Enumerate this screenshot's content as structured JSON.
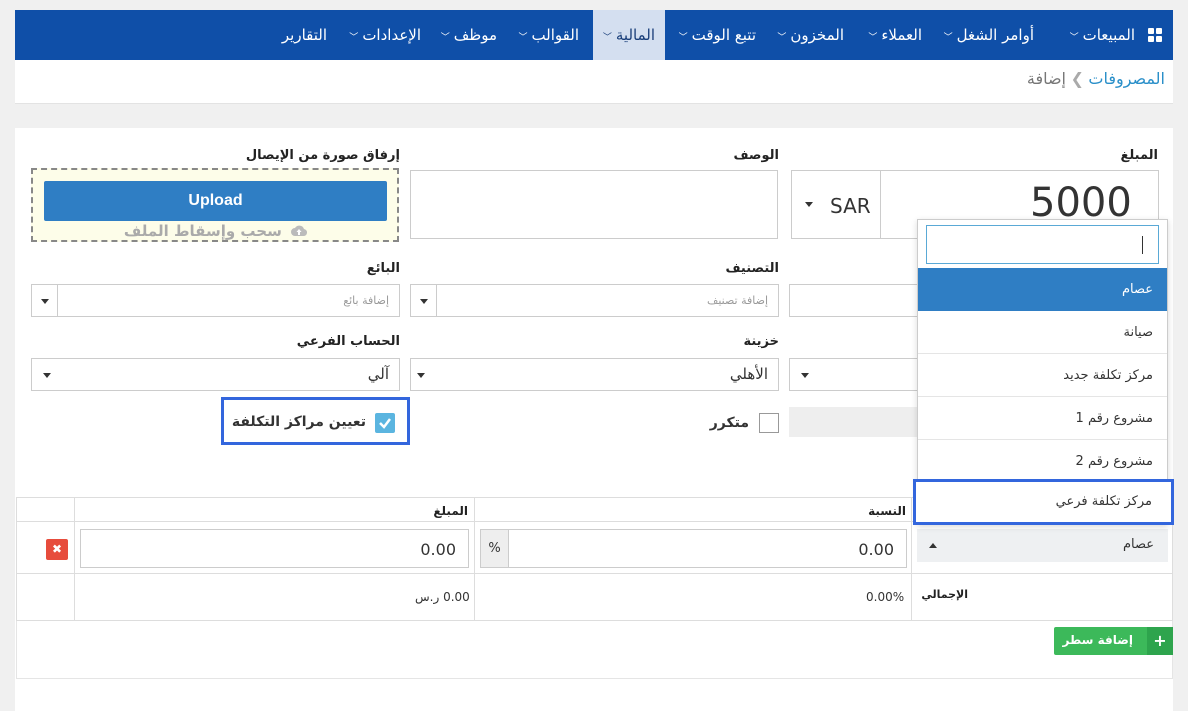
{
  "nav": {
    "items": [
      {
        "label": "المبيعات",
        "arrow": true
      },
      {
        "label": "أوامر الشغل",
        "arrow": true
      },
      {
        "label": "العملاء",
        "arrow": true
      },
      {
        "label": "المخزون",
        "arrow": true
      },
      {
        "label": "تتبع الوقت",
        "arrow": true
      },
      {
        "label": "المالية",
        "arrow": true
      },
      {
        "label": "القوالب",
        "arrow": true
      },
      {
        "label": "موظف",
        "arrow": true
      },
      {
        "label": "الإعدادات",
        "arrow": true
      },
      {
        "label": "التقارير",
        "arrow": false
      }
    ]
  },
  "breadcrumb": {
    "parent": "المصروفات",
    "current": "إضافة"
  },
  "form": {
    "amount_label": "المبلغ",
    "amount_value": "5000",
    "currency": "SAR",
    "description_label": "الوصف",
    "attach_label": "إرفاق صورة من الإيصال",
    "upload_button": "Upload",
    "drop_text": "سحب وإسقاط الملف",
    "vendor_label": "البائع",
    "vendor_placeholder": "إضافة بائع",
    "category_label": "التصنيف",
    "category_placeholder": "إضافة تصنيف",
    "subaccount_label": "الحساب الفرعي",
    "subaccount_value": "آلي",
    "treasury_label": "خزينة",
    "treasury_value": "الأهلي",
    "cost_centers_label": "تعيين مراكز التكلفة",
    "recurring_label": "متكرر"
  },
  "dropdown": {
    "options": [
      "عصام",
      "صيانة",
      "مركز تكلفة جديد",
      "مشروع رقم 1",
      "مشروع رقم 2",
      "مركز تكلفة فرعي"
    ]
  },
  "cost_table": {
    "col_percent": "النسبة",
    "col_amount": "المبلغ",
    "row_center": "عصام",
    "row_percent": "0.00",
    "percent_sign": "%",
    "row_amount": "0.00",
    "total_label": "الإجمالي",
    "total_percent": "0.00%",
    "total_amount": "0.00 ر.س",
    "add_row": "إضافة سطر"
  },
  "colors": {
    "nav": "#0f4fa8",
    "accent": "#2f7ec4",
    "highlight": "#3366dd",
    "green": "#3cb95a",
    "red": "#e74c3c"
  }
}
